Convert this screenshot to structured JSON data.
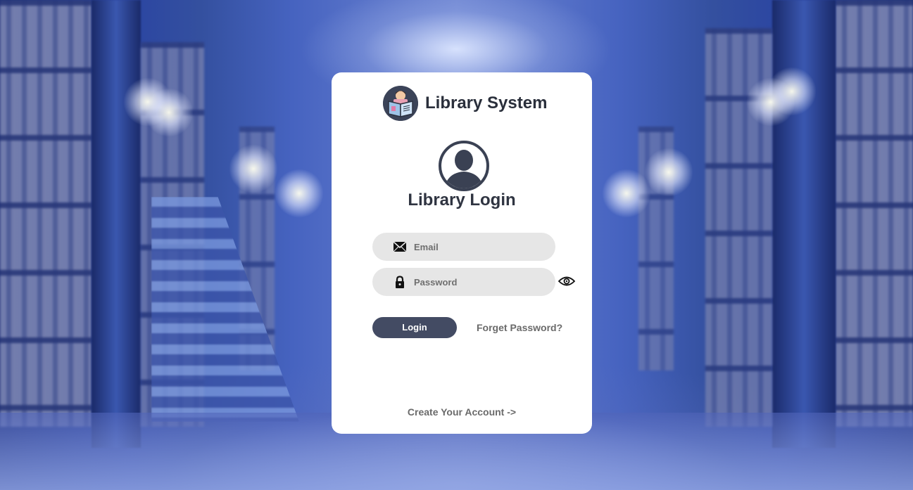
{
  "brand": {
    "title": "Library System",
    "logo_icon": "reading-person-icon"
  },
  "login": {
    "avatar_icon": "user-avatar-icon",
    "title": "Library Login",
    "email": {
      "icon": "envelope-icon",
      "placeholder": "Email",
      "value": ""
    },
    "password": {
      "icon": "lock-icon",
      "placeholder": "Password",
      "value": "",
      "toggle_icon": "eye-icon"
    },
    "login_button_label": "Login",
    "forget_password_label": "Forget Password?",
    "create_account_label": "Create Your Account ->"
  },
  "colors": {
    "button": "#434b63",
    "field_bg": "#e6e6e6",
    "title_text": "#2a2f3b",
    "link_text": "#6a6a6a",
    "background_blue": "#2b45a2"
  }
}
